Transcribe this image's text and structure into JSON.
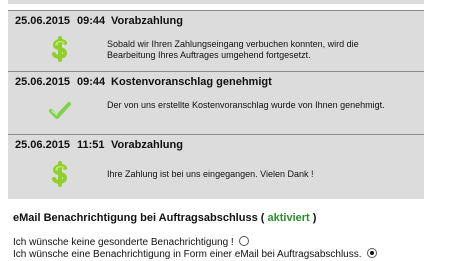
{
  "entries": [
    {
      "date": "25.06.2015",
      "time": "09:44",
      "title": "Vorabzahlung",
      "icon": "dollar-icon",
      "message": "Sobald wir Ihren Zahlungseingang verbuchen konnten, wird die Bearbeitung Ihres Auftrages umgehend fortgesetzt."
    },
    {
      "date": "25.06.2015",
      "time": "09:44",
      "title": "Kostenvoranschlag genehmigt",
      "icon": "checkmark-icon",
      "message": "Der von uns erstellte Kostenvoranschlag wurde von Ihnen genehmigt."
    },
    {
      "date": "25.06.2015",
      "time": "11:51",
      "title": "Vorabzahlung",
      "icon": "dollar-icon",
      "message": "Ihre Zahlung ist bei uns eingegangen. Vielen Dank !"
    }
  ],
  "notification": {
    "heading": "eMail Benachrichtigung bei Auftragsabschluss",
    "status_open": "(",
    "status": "aktiviert",
    "status_close": ")",
    "options": [
      {
        "label": "Ich wünsche keine gesonderte Benachrichtigung !",
        "selected": false
      },
      {
        "label": "Ich wünsche eine Benachrichtigung in Form einer eMail bei Auftragsabschluss.",
        "selected": true
      }
    ]
  },
  "colors": {
    "entry_background": "#dcdcdc",
    "dollar_icon": "#8fcf2a",
    "checkmark_icon": "#7fd34a",
    "status_active": "#2e8b2e"
  }
}
